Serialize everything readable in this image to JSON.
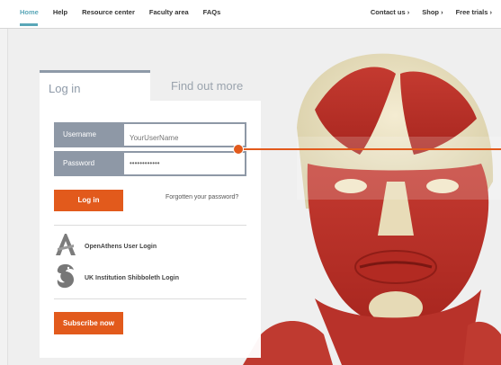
{
  "nav": {
    "left": [
      "Home",
      "Help",
      "Resource center",
      "Faculty area",
      "FAQs"
    ],
    "right": [
      "Contact us ›",
      "Shop ›",
      "Free trials ›"
    ]
  },
  "tabs": {
    "login": "Log in",
    "find_out": "Find out more"
  },
  "form": {
    "username_label": "Username",
    "username_placeholder": "YourUserName",
    "password_label": "Password",
    "password_value": "••••••••••••",
    "login_button": "Log in",
    "forgot_link": "Forgotten your password?"
  },
  "institution": {
    "openathens": "OpenAthens User Login",
    "shibboleth": "UK Institution Shibboleth Login"
  },
  "subscribe_button": "Subscribe now",
  "colors": {
    "accent": "#e25a1c",
    "nav_active": "#5aa7b8",
    "field_bg": "#8e98a6"
  }
}
